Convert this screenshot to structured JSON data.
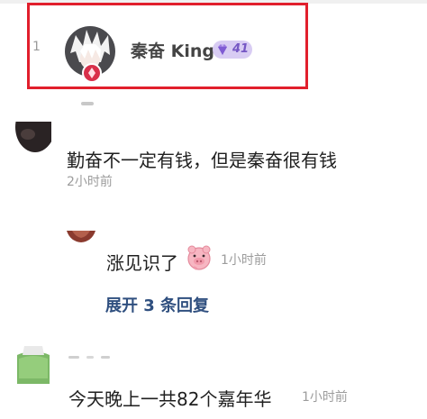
{
  "highlighted_comment": {
    "rank": "1",
    "avatar_icon": "white-haired-anime-avatar",
    "badge_icon": "red-gift-badge-icon",
    "username": "秦奋 King",
    "level": "41",
    "level_icon": "purple-gem-icon",
    "highlight_color": "#e11f2c"
  },
  "comments": [
    {
      "text": "勤奋不一定有钱，但是秦奋很有钱",
      "time": "2小时前",
      "replies": [
        {
          "text": "涨见识了",
          "sticker_icon": "pink-pig-sticker-icon",
          "time": "1小时前"
        }
      ],
      "expand_label": "展开 3 条回复"
    },
    {
      "text": "今天晚上一共82个嘉年华",
      "time": "1小时前"
    }
  ],
  "colors": {
    "link": "#2f4f7f",
    "meta": "#9c9c9c",
    "level_bg": "#d8ccf3",
    "level_text": "#7557c4"
  }
}
